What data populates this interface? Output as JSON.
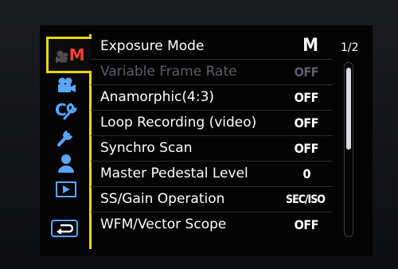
{
  "active_tab": {
    "label": "M",
    "icon": "movie-camera-icon",
    "color": "#ff3d33"
  },
  "tabs": [
    {
      "name": "motion-picture",
      "icon": "movie-camera-icon"
    },
    {
      "name": "custom",
      "icon": "custom-wrench-icon"
    },
    {
      "name": "setup",
      "icon": "wrench-icon"
    },
    {
      "name": "my-menu",
      "icon": "person-icon"
    },
    {
      "name": "playback",
      "icon": "play-icon"
    }
  ],
  "back_button": {
    "icon": "return-arrow-icon"
  },
  "page_indicator": "1/2",
  "scroll_fraction": 0.5,
  "menu": [
    {
      "label": "Exposure Mode",
      "value": "M",
      "enabled": true
    },
    {
      "label": "Variable Frame Rate",
      "value": "OFF",
      "enabled": false
    },
    {
      "label": "Anamorphic(4:3)",
      "value": "OFF",
      "enabled": true
    },
    {
      "label": "Loop Recording (video)",
      "value": "OFF",
      "enabled": true
    },
    {
      "label": "Synchro Scan",
      "value": "OFF",
      "enabled": true
    },
    {
      "label": "Master Pedestal Level",
      "value": "0",
      "enabled": true
    },
    {
      "label": "SS/Gain Operation",
      "value": "SEC/ISO",
      "enabled": true
    },
    {
      "label": "WFM/Vector Scope",
      "value": "OFF",
      "enabled": true
    }
  ],
  "colors": {
    "highlight": "#e8d800",
    "icon_blue": "#5aa6ff",
    "disabled_text": "#5b5e66"
  }
}
